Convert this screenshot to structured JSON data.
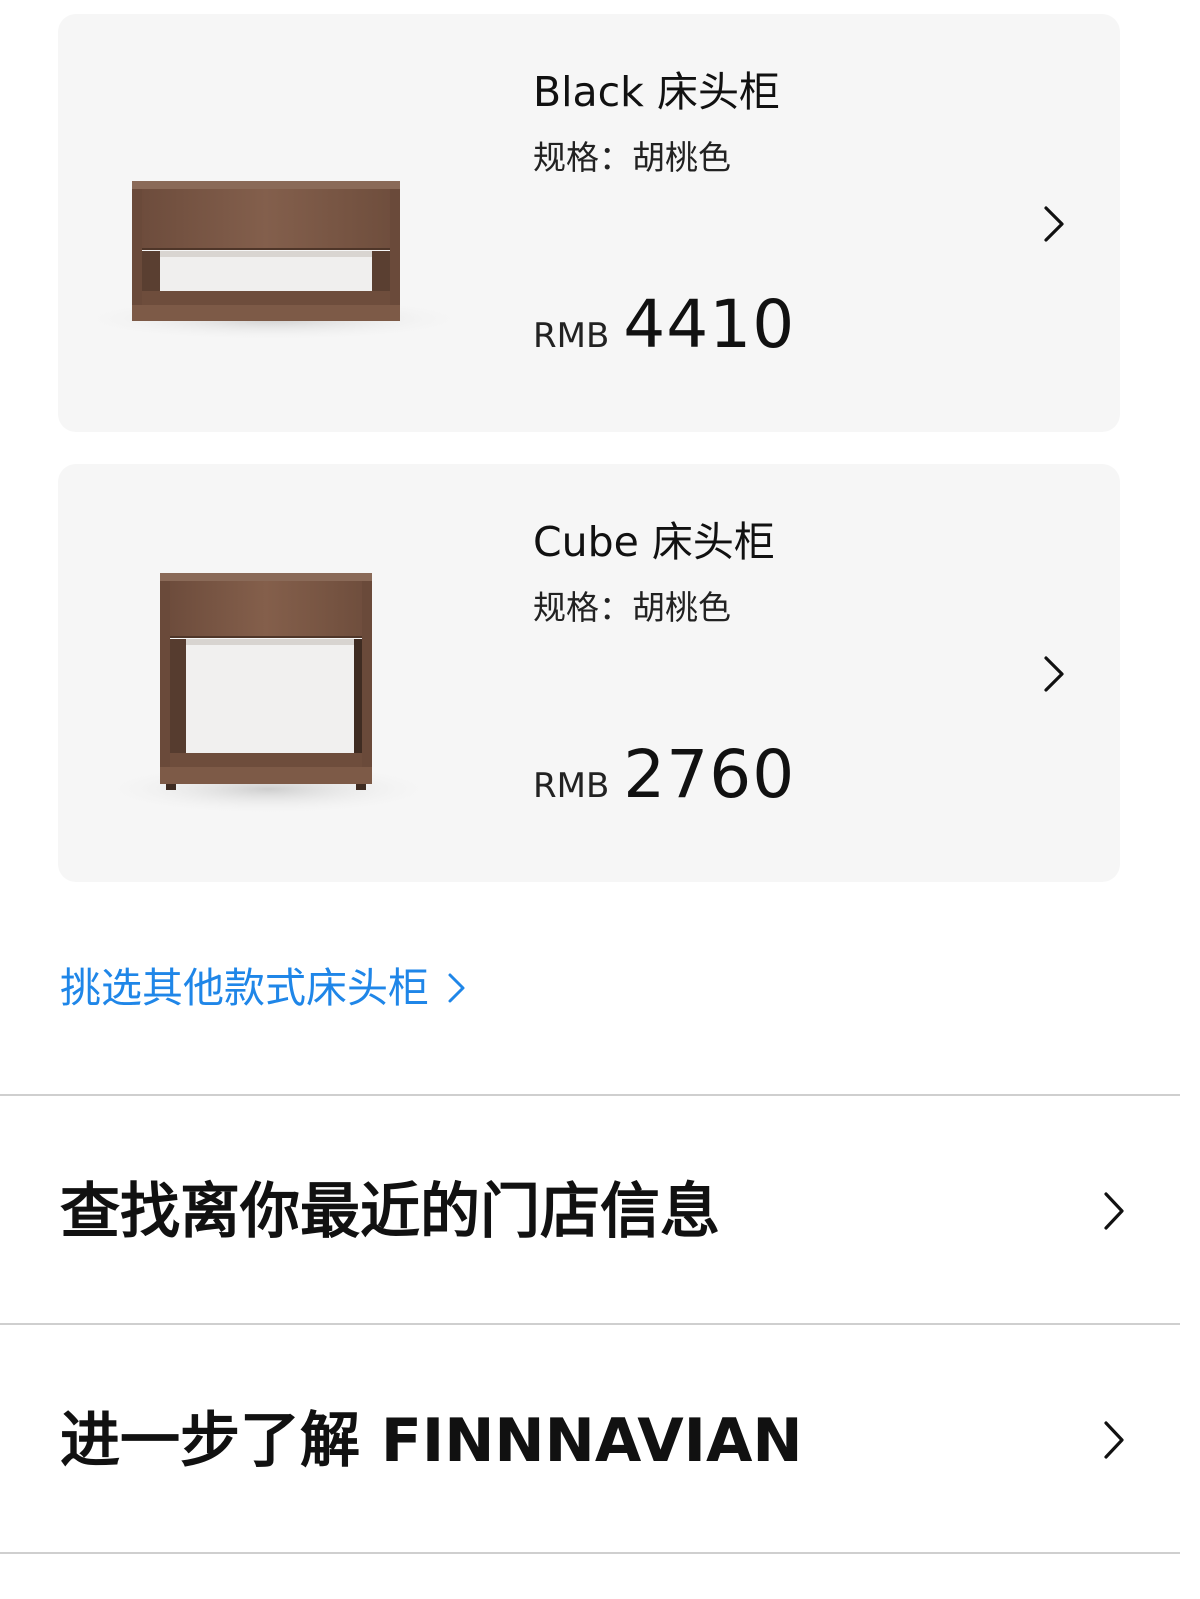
{
  "products": [
    {
      "name": "Black 床头柜",
      "spec": "规格：胡桃色",
      "currency": "RMB",
      "price": "4410",
      "image_icon": "walnut-wide-nightstand-image",
      "chevron_icon": "chevron-right-icon"
    },
    {
      "name": "Cube 床头柜",
      "spec": "规格：胡桃色",
      "currency": "RMB",
      "price": "2760",
      "image_icon": "walnut-cube-nightstand-image",
      "chevron_icon": "chevron-right-icon"
    }
  ],
  "more_link": {
    "label": "挑选其他款式床头柜",
    "color": "#1f86e8",
    "chevron_icon": "chevron-right-icon"
  },
  "menu": [
    {
      "label": "查找离你最近的门店信息",
      "chevron_icon": "chevron-right-icon"
    },
    {
      "label": "进一步了解 FINNNAVIAN",
      "chevron_icon": "chevron-right-icon"
    }
  ],
  "colors": {
    "card_background": "#f6f6f6",
    "walnut": "#7a5846",
    "divider": "#cfcfcf"
  }
}
